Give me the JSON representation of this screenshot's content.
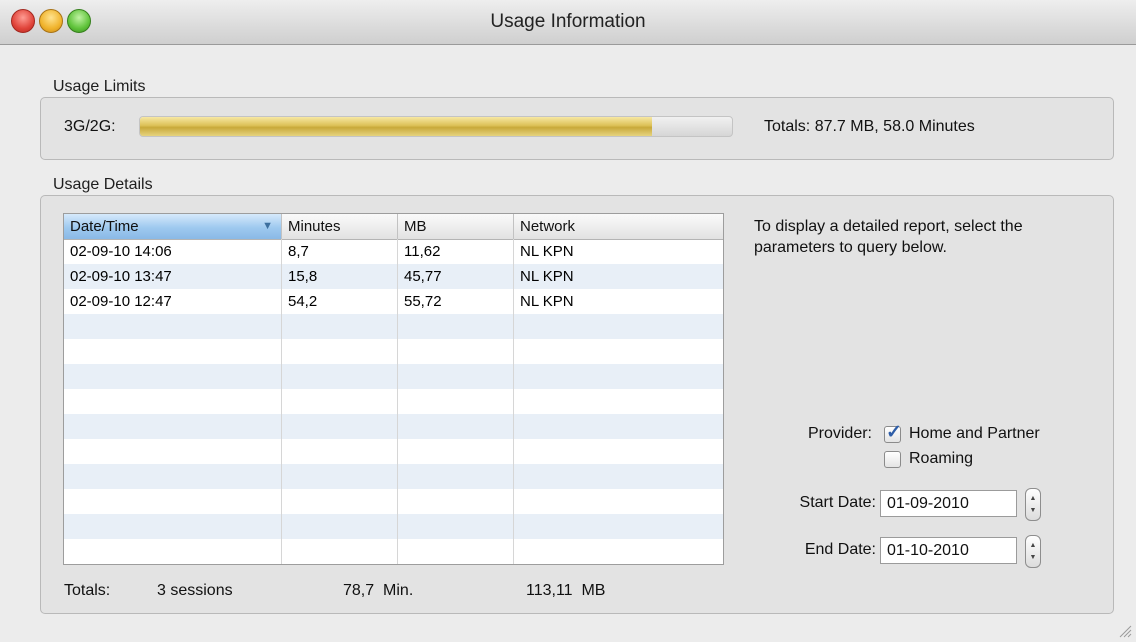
{
  "window": {
    "title": "Usage Information"
  },
  "usage_limits": {
    "section_label": "Usage Limits",
    "bar_label": "3G/2G:",
    "bar_fill_fraction": 0.865,
    "bar_color": "#dcc157",
    "totals_text": "Totals: 87.7 MB, 58.0 Minutes"
  },
  "usage_details": {
    "section_label": "Usage Details",
    "table": {
      "columns": [
        "Date/Time",
        "Minutes",
        "MB",
        "Network"
      ],
      "sorted_column": "Date/Time",
      "rows": [
        [
          "02-09-10 14:06",
          "8,7",
          "11,62",
          "NL KPN"
        ],
        [
          "02-09-10 13:47",
          "15,8",
          "45,77",
          "NL KPN"
        ],
        [
          "02-09-10 12:47",
          "54,2",
          "55,72",
          "NL KPN"
        ]
      ],
      "empty_rows": 10
    },
    "summary": {
      "label": "Totals:",
      "sessions": "3 sessions",
      "minutes": "78,7  Min.",
      "mb": "113,11  MB"
    },
    "description": "To display a detailed report, select the parameters to query below.",
    "provider_label": "Provider:",
    "provider_options": [
      {
        "label": "Home and Partner",
        "checked": true
      },
      {
        "label": "Roaming",
        "checked": false
      }
    ],
    "start_date_label": "Start Date:",
    "start_date": "01-09-2010",
    "end_date_label": "End Date:",
    "end_date": "01-10-2010"
  }
}
